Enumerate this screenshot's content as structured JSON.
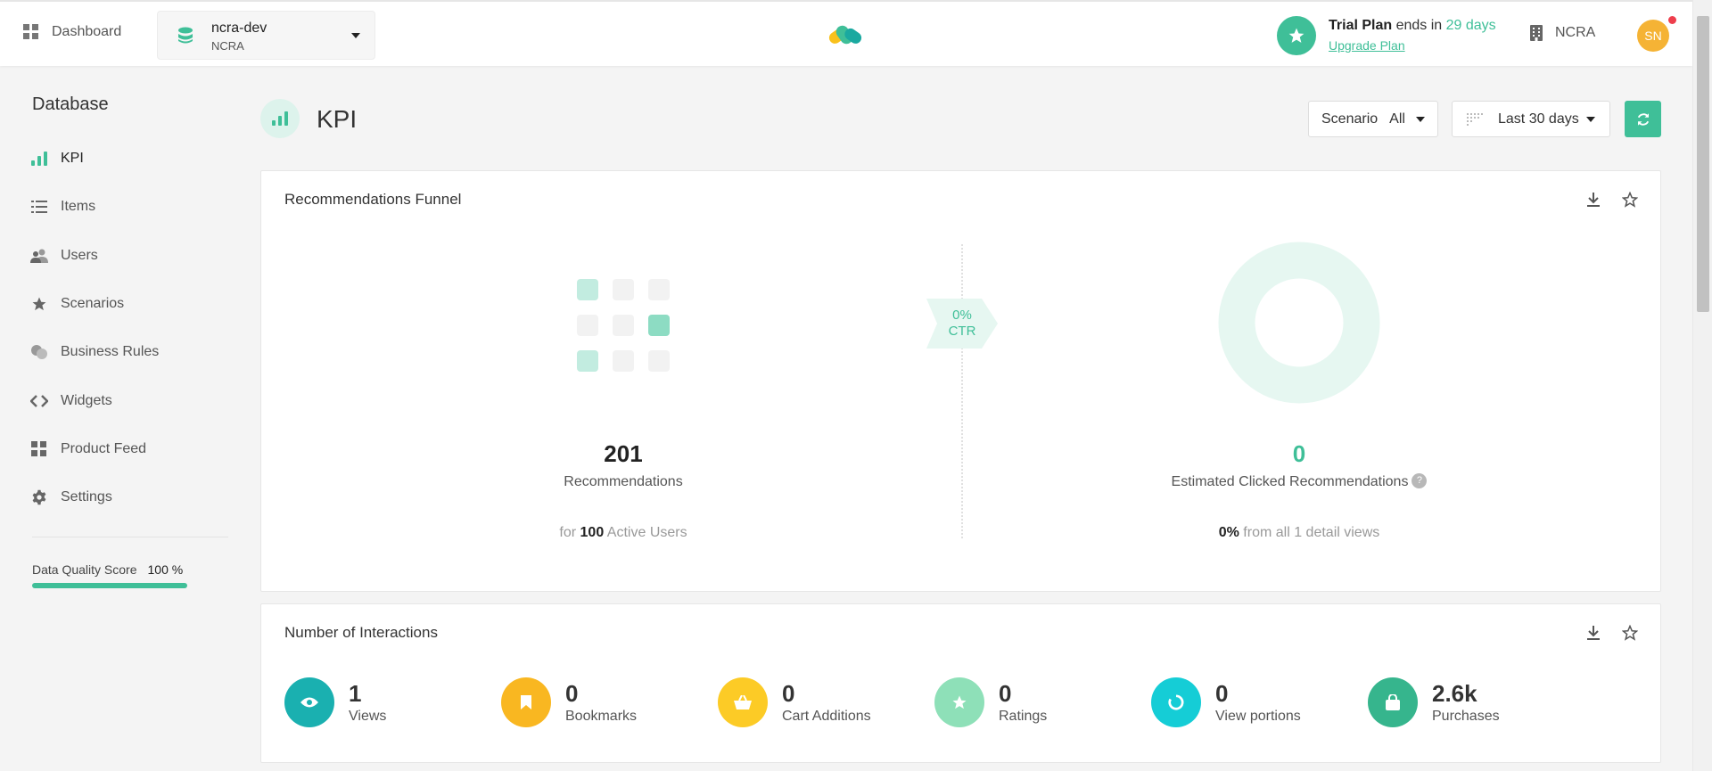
{
  "topbar": {
    "dashboard_label": "Dashboard",
    "database": {
      "name": "ncra-dev",
      "org": "NCRA"
    },
    "trial": {
      "plan": "Trial Plan",
      "ends_in": " ends in ",
      "days": "29 days",
      "upgrade_label": "Upgrade Plan"
    },
    "org_label": "NCRA",
    "avatar_initials": "SN"
  },
  "sidebar": {
    "title": "Database",
    "items": [
      {
        "label": "KPI",
        "icon": "bar-chart-icon",
        "active": true
      },
      {
        "label": "Items",
        "icon": "list-icon"
      },
      {
        "label": "Users",
        "icon": "users-icon"
      },
      {
        "label": "Scenarios",
        "icon": "star-icon"
      },
      {
        "label": "Business Rules",
        "icon": "circles-icon"
      },
      {
        "label": "Widgets",
        "icon": "code-icon"
      },
      {
        "label": "Product Feed",
        "icon": "grid-icon"
      },
      {
        "label": "Settings",
        "icon": "gear-icon"
      }
    ],
    "data_quality": {
      "label": "Data Quality Score",
      "value": "100 %",
      "fraction": 1.0
    }
  },
  "page": {
    "title": "KPI",
    "scenario": {
      "label": "Scenario",
      "value": "All"
    },
    "date_range": "Last 30 days"
  },
  "funnel": {
    "title": "Recommendations Funnel",
    "recommendations": {
      "value": "201",
      "label": "Recommendations",
      "sub_prefix": "for ",
      "sub_value": "100",
      "sub_suffix": " Active Users"
    },
    "ctr": {
      "value": "0%",
      "label": "CTR"
    },
    "clicked": {
      "value": "0",
      "label": "Estimated Clicked Recommendations",
      "help": "?",
      "sub_value": "0%",
      "sub_suffix": " from all 1 detail views"
    }
  },
  "interactions": {
    "title": "Number of Interactions",
    "items": [
      {
        "value": "1",
        "label": "Views",
        "color": "#1ab0b0",
        "icon": "eye-icon"
      },
      {
        "value": "0",
        "label": "Bookmarks",
        "color": "#f9b721",
        "icon": "bookmark-icon"
      },
      {
        "value": "0",
        "label": "Cart Additions",
        "color": "#fccb26",
        "icon": "basket-icon"
      },
      {
        "value": "0",
        "label": "Ratings",
        "color": "#8ee0b8",
        "icon": "star-icon"
      },
      {
        "value": "0",
        "label": "View portions",
        "color": "#15cdd6",
        "icon": "portion-icon"
      },
      {
        "value": "2.6k",
        "label": "Purchases",
        "color": "#36b58d",
        "icon": "bag-icon"
      }
    ]
  },
  "colors": {
    "accent": "#3fbf98",
    "avatar": "#f5b335",
    "notification": "#ee3e4c"
  }
}
